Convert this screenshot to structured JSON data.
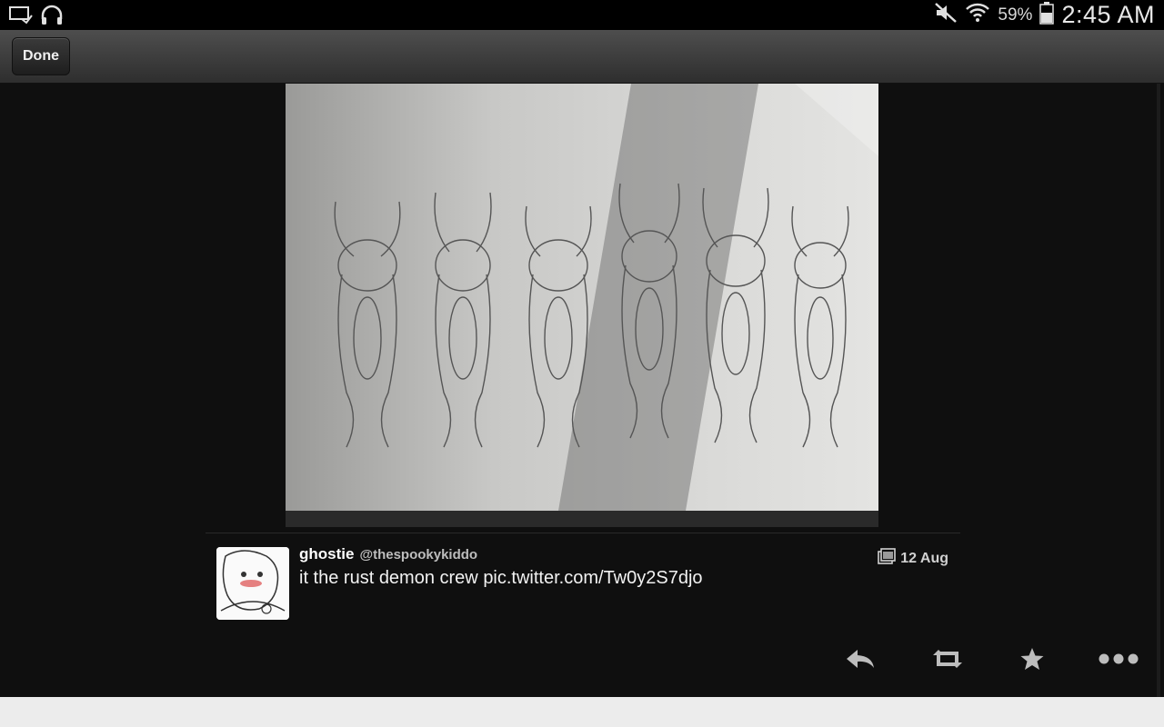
{
  "status_bar": {
    "battery_percent": "59%",
    "time": "2:45 AM",
    "icons": [
      "cast-screen-icon",
      "headphones-icon",
      "mute-icon",
      "wifi-icon",
      "battery-icon"
    ]
  },
  "toolbar": {
    "done_label": "Done"
  },
  "tweet": {
    "display_name": "ghostie",
    "handle": "@thespookykiddo",
    "text_plain": "it the rust demon crew ",
    "text_link": "pic.twitter.com/Tw0y2S7djo",
    "date": "12 Aug",
    "media_icon": "image-gallery-icon",
    "avatar_icon": "avatar-drawing"
  },
  "actions": {
    "icons": [
      "reply-icon",
      "retweet-icon",
      "favorite-star-icon",
      "more-dots-icon"
    ]
  },
  "colors": {
    "background": "#0f0f0f",
    "toolbar_top": "#4e4e4e",
    "toolbar_bottom": "#2e2e2e",
    "status_bar": "#000000",
    "text_primary": "#f2f2f2",
    "icon_gray": "#bfbfbf"
  }
}
